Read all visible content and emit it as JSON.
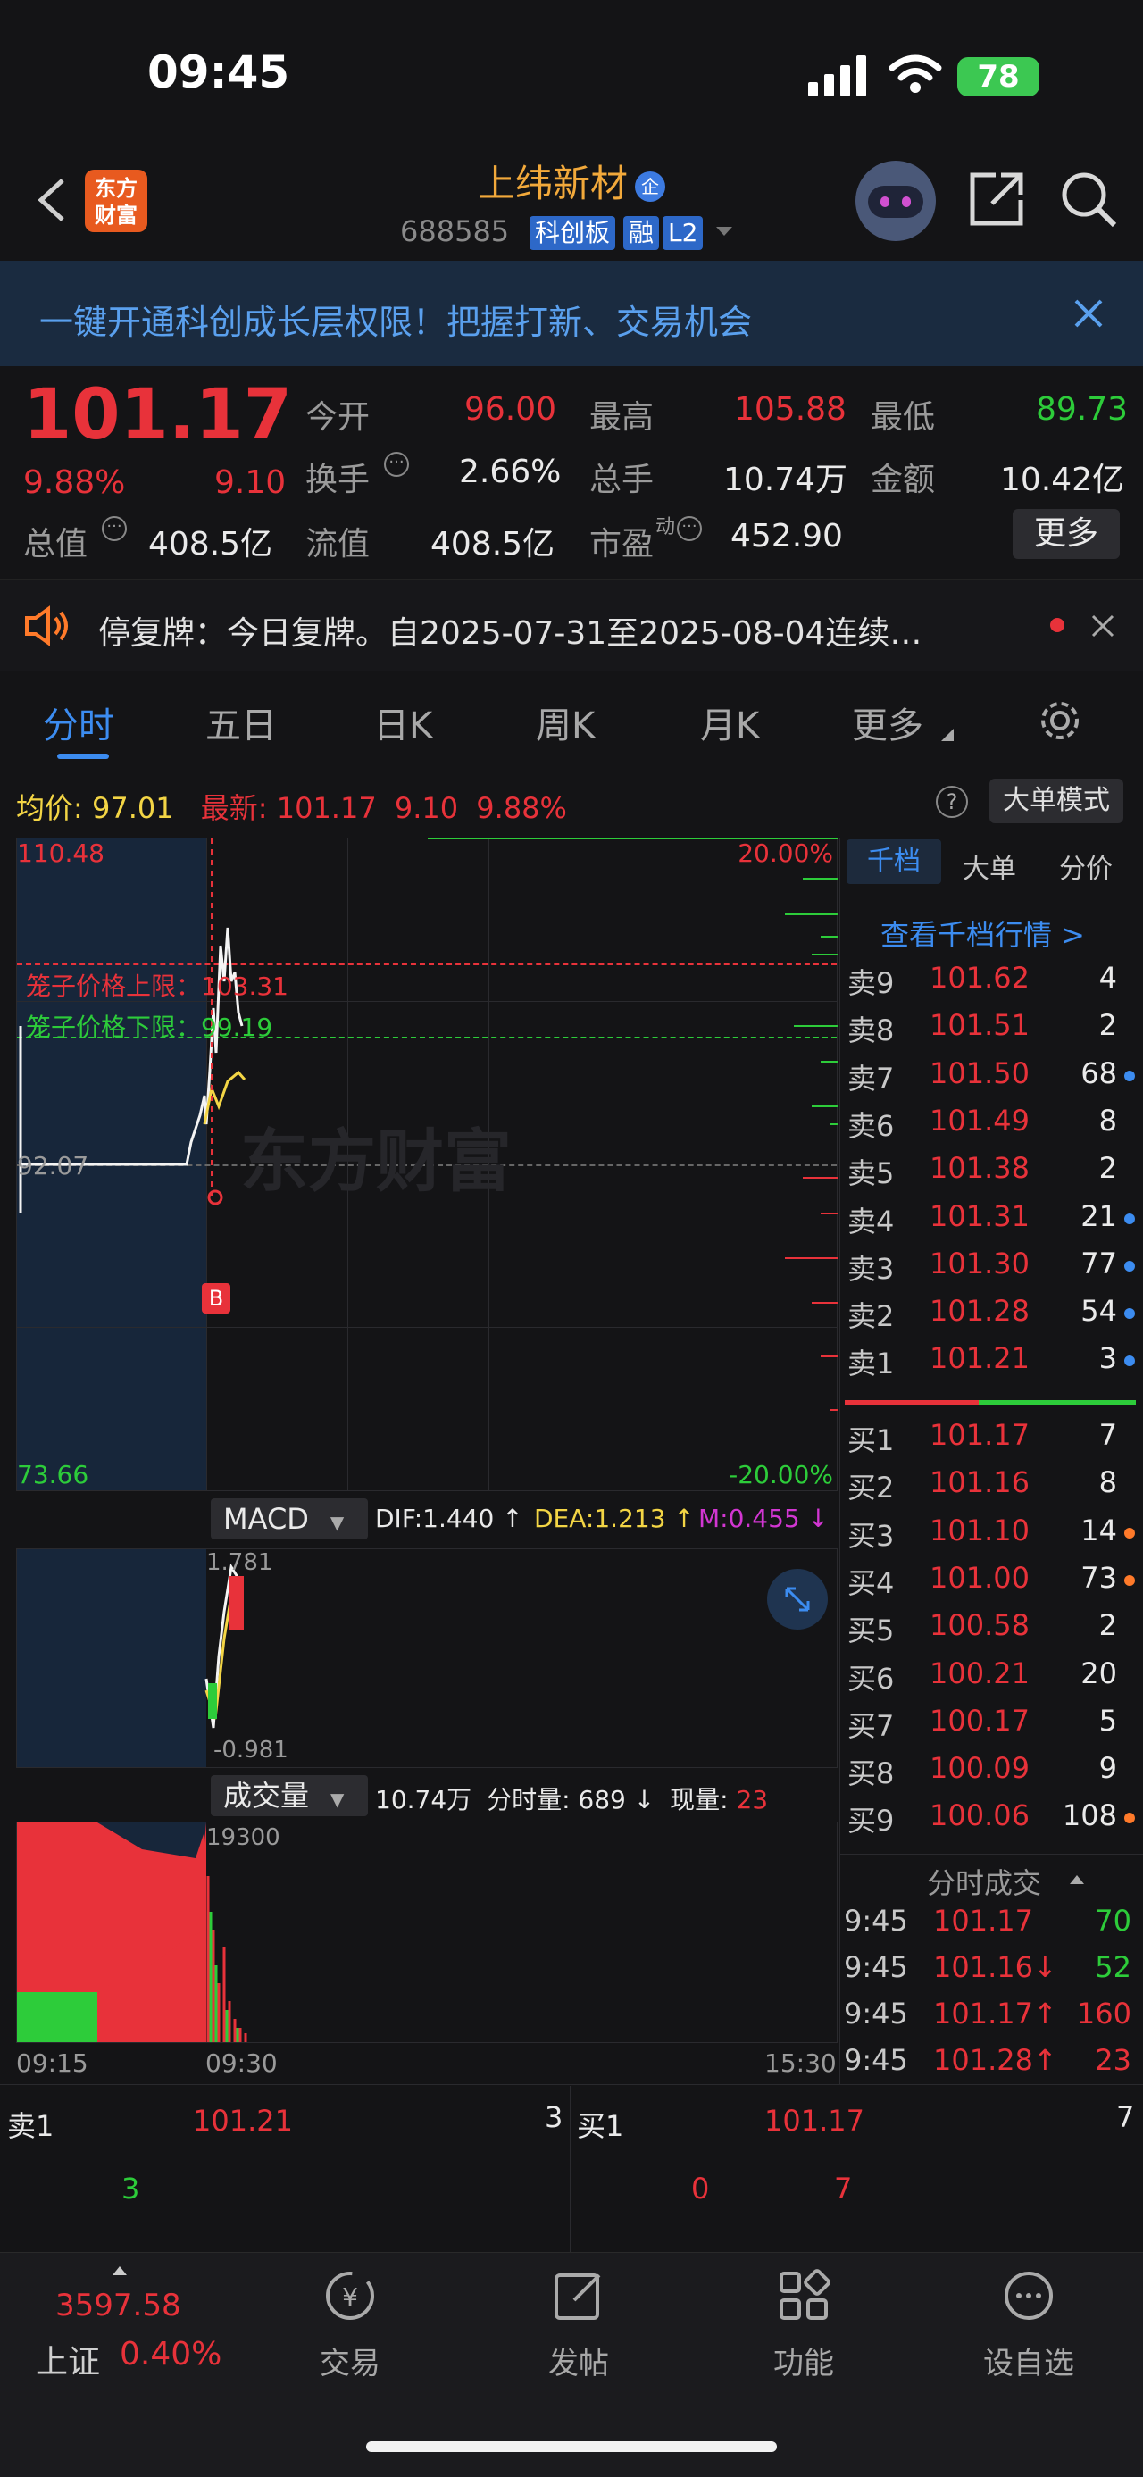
{
  "status_bar": {
    "time": "09:45",
    "battery": "78"
  },
  "header": {
    "stock_name": "上纬新材",
    "stock_code": "688585",
    "tags": [
      "科创板",
      "融",
      "L2"
    ],
    "logo_text": "东方财富"
  },
  "banner": {
    "text": "一键开通科创成长层权限！把握打新、交易机会"
  },
  "quote": {
    "price": "101.17",
    "change_pct": "9.88%",
    "change": "9.10",
    "open_label": "今开",
    "open": "96.00",
    "high_label": "最高",
    "high": "105.88",
    "low_label": "最低",
    "low": "89.73",
    "turnover_label": "换手",
    "turnover": "2.66%",
    "volume_label": "总手",
    "volume": "10.74万",
    "amount_label": "金额",
    "amount": "10.42亿",
    "total_mv_label": "总值",
    "total_mv": "408.5亿",
    "float_mv_label": "流值",
    "float_mv": "408.5亿",
    "pe_label": "市盈",
    "pe_sup": "动",
    "pe": "452.90",
    "more": "更多"
  },
  "notice": {
    "text": "停复牌：今日复牌。自2025-07-31至2025-08-04连续…"
  },
  "tabs": [
    "分时",
    "五日",
    "日K",
    "周K",
    "月K",
    "更多"
  ],
  "chart_header": {
    "avg_label": "均价:",
    "avg": "97.01",
    "latest_label": "最新:",
    "latest": "101.17",
    "change": "9.10",
    "change_pct": "9.88%",
    "mode_button": "大单模式"
  },
  "price_chart": {
    "top_price": "110.48",
    "bottom_price": "73.66",
    "top_pct": "20.00%",
    "bottom_pct": "-20.00%",
    "base_price": "92.07",
    "cage_upper": "笼子价格上限：103.31",
    "cage_lower": "笼子价格下限：99.19",
    "marker": "B",
    "watermark": "东方财富"
  },
  "macd": {
    "label": "MACD",
    "dif": "DIF:1.440 ↑",
    "dea": "DEA:1.213 ↑",
    "m": "M:0.455 ↓",
    "top": "1.781",
    "bottom": "-0.981"
  },
  "vol": {
    "label": "成交量",
    "total": "10.74万",
    "min_vol_label": "分时量:",
    "min_vol": "689 ↓",
    "now_label": "现量:",
    "now": "23",
    "top": "19300"
  },
  "time_axis": [
    "09:15",
    "09:30",
    "15:30"
  ],
  "orderbook": {
    "tabs": [
      "千档",
      "大单",
      "分价"
    ],
    "link": "查看千档行情 >",
    "sells": [
      [
        "卖9",
        "101.62",
        "4",
        ""
      ],
      [
        "卖8",
        "101.51",
        "2",
        ""
      ],
      [
        "卖7",
        "101.50",
        "68",
        "blue"
      ],
      [
        "卖6",
        "101.49",
        "8",
        ""
      ],
      [
        "卖5",
        "101.38",
        "2",
        ""
      ],
      [
        "卖4",
        "101.31",
        "21",
        "blue"
      ],
      [
        "卖3",
        "101.30",
        "77",
        "blue"
      ],
      [
        "卖2",
        "101.28",
        "54",
        "blue"
      ],
      [
        "卖1",
        "101.21",
        "3",
        "blue"
      ]
    ],
    "buys": [
      [
        "买1",
        "101.17",
        "7",
        ""
      ],
      [
        "买2",
        "101.16",
        "8",
        ""
      ],
      [
        "买3",
        "101.10",
        "14",
        "orange"
      ],
      [
        "买4",
        "101.00",
        "73",
        "orange"
      ],
      [
        "买5",
        "100.58",
        "2",
        ""
      ],
      [
        "买6",
        "100.21",
        "20",
        ""
      ],
      [
        "买7",
        "100.17",
        "5",
        ""
      ],
      [
        "买8",
        "100.09",
        "9",
        ""
      ],
      [
        "买9",
        "100.06",
        "108",
        "orange"
      ]
    ],
    "ticks_title": "分时成交",
    "ticks": [
      [
        "9:45",
        "101.17",
        "70",
        "green"
      ],
      [
        "9:45",
        "101.16↓",
        "52",
        "green"
      ],
      [
        "9:45",
        "101.17↑",
        "160",
        "red"
      ],
      [
        "9:45",
        "101.28↑",
        "23",
        "red"
      ]
    ]
  },
  "level1": {
    "sell_label": "卖1",
    "sell_price": "101.21",
    "sell_qty": "3",
    "sell_detail": "3",
    "buy_label": "买1",
    "buy_price": "101.17",
    "buy_qty": "7",
    "buy_detail_a": "0",
    "buy_detail_b": "7"
  },
  "bottom_nav": {
    "index_value": "3597.58",
    "index_name": "上证",
    "index_pct": "0.40%",
    "items": [
      "交易",
      "发帖",
      "功能",
      "设自选"
    ]
  },
  "colors": {
    "up": "#e8323a",
    "down": "#2dcc3a",
    "accent": "#3c8cf0",
    "brand": "#e85a1f"
  }
}
